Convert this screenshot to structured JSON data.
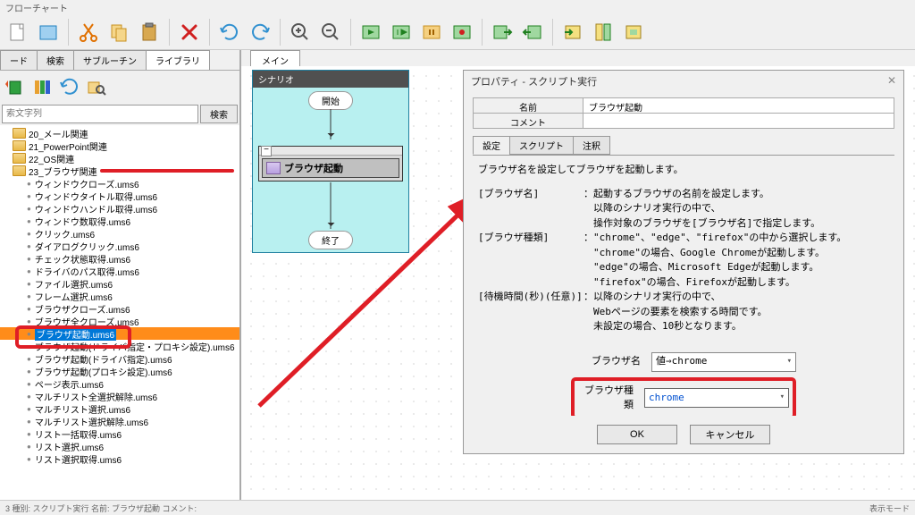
{
  "title": "フローチャート",
  "left_tabs": [
    "ード",
    "検索",
    "サブルーチン",
    "ライブラリ"
  ],
  "search": {
    "placeholder": "索文字列",
    "button": "検索"
  },
  "tree": [
    {
      "type": "folder",
      "label": "20_メール関連"
    },
    {
      "type": "folder",
      "label": "21_PowerPoint関連"
    },
    {
      "type": "folder",
      "label": "22_OS関連"
    },
    {
      "type": "folder",
      "label": "23_ブラウザ関連",
      "redline": true
    },
    {
      "type": "file",
      "label": "ウィンドウクローズ.ums6"
    },
    {
      "type": "file",
      "label": "ウィンドウタイトル取得.ums6"
    },
    {
      "type": "file",
      "label": "ウィンドウハンドル取得.ums6"
    },
    {
      "type": "file",
      "label": "ウィンドウ数取得.ums6"
    },
    {
      "type": "file",
      "label": "クリック.ums6"
    },
    {
      "type": "file",
      "label": "ダイアログクリック.ums6"
    },
    {
      "type": "file",
      "label": "チェック状態取得.ums6"
    },
    {
      "type": "file",
      "label": "ドライバのパス取得.ums6"
    },
    {
      "type": "file",
      "label": "ファイル選択.ums6"
    },
    {
      "type": "file",
      "label": "フレーム選択.ums6"
    },
    {
      "type": "file",
      "label": "ブラウザクローズ.ums6"
    },
    {
      "type": "file",
      "label": "ブラウザ全クローズ.ums6"
    },
    {
      "type": "file",
      "label": "ブラウザ起動.ums6",
      "selected": true
    },
    {
      "type": "file",
      "label": "ブラウザ起動(ドライバ指定・プロキシ設定).ums6"
    },
    {
      "type": "file",
      "label": "ブラウザ起動(ドライバ指定).ums6"
    },
    {
      "type": "file",
      "label": "ブラウザ起動(プロキシ設定).ums6"
    },
    {
      "type": "file",
      "label": "ページ表示.ums6"
    },
    {
      "type": "file",
      "label": "マルチリスト全選択解除.ums6"
    },
    {
      "type": "file",
      "label": "マルチリスト選択.ums6"
    },
    {
      "type": "file",
      "label": "マルチリスト選択解除.ums6"
    },
    {
      "type": "file",
      "label": "リスト一括取得.ums6"
    },
    {
      "type": "file",
      "label": "リスト選択.ums6"
    },
    {
      "type": "file",
      "label": "リスト選択取得.ums6"
    }
  ],
  "main_tab": "メイン",
  "scenario": {
    "title": "シナリオ",
    "start": "開始",
    "action": "ブラウザ起動",
    "end": "終了"
  },
  "prop": {
    "title": "プロパティ - スクリプト実行",
    "name_label": "名前",
    "name_value": "ブラウザ起動",
    "comment_label": "コメント",
    "comment_value": "",
    "tabs": [
      "設定",
      "スクリプト",
      "注釈"
    ],
    "intro": "ブラウザ名を設定してブラウザを起動します。",
    "rows": [
      {
        "k": "[ブラウザ名]",
        "v": [
          "：起動するブラウザの名前を設定します。",
          "　以降のシナリオ実行の中で、",
          "　操作対象のブラウザを[ブラウザ名]で指定します。"
        ]
      },
      {
        "k": "[ブラウザ種類]",
        "v": [
          "：\"chrome\"、\"edge\"、\"firefox\"の中から選択します。",
          "　\"chrome\"の場合、Google Chromeが起動します。",
          "　\"edge\"の場合、Microsoft Edgeが起動します。",
          "　\"firefox\"の場合、Firefoxが起動します。"
        ]
      },
      {
        "k": "[待機時間(秒)(任意)]",
        "v": [
          "：以降のシナリオ実行の中で、",
          "　Webページの要素を検索する時間です。",
          "　未設定の場合、10秒となります。"
        ]
      }
    ],
    "cfg1_label": "ブラウザ名",
    "cfg1_value": "値⇒chrome",
    "cfg2_label": "ブラウザ種類",
    "cfg2_value": "chrome",
    "ok": "OK",
    "cancel": "キャンセル"
  },
  "status_left": "3  種別: スクリプト実行  名前: ブラウザ起動  コメント:",
  "status_right": "表示モード"
}
